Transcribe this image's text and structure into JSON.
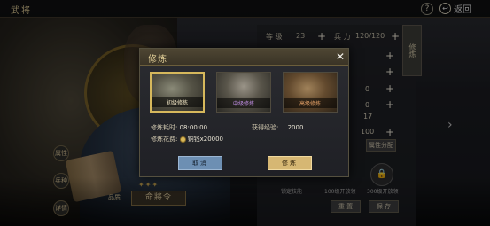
{
  "topbar": {
    "title": "武将",
    "help": "?",
    "back_label": "返回"
  },
  "stats": [
    {
      "label": "等 级",
      "value": "23"
    },
    {
      "label": "兵 力",
      "value": "120/120"
    }
  ],
  "side_tab": "修炼",
  "right_values": [
    "0",
    "0",
    "0",
    "0",
    "17",
    "100"
  ],
  "right_panel": {
    "small_btn": "属性分配",
    "cap_1": "锁定技能",
    "cap_2": "100级开放领",
    "cap_3": "300级开放领",
    "bottom_btn_1": "重 置",
    "bottom_btn_2": "保 存"
  },
  "left_buttons": [
    "属性",
    "兵种",
    "详情"
  ],
  "hero": {
    "tag": "品质",
    "name": "命將令",
    "stars": "✦✦✦"
  },
  "modal": {
    "title": "修炼",
    "options": [
      {
        "label": "初级修炼",
        "selected": true
      },
      {
        "label": "中级修炼",
        "selected": false
      },
      {
        "label": "高级修炼",
        "selected": false
      }
    ],
    "duration_label": "修炼耗时:",
    "duration_value": "08:00:00",
    "exp_label": "获得经验:",
    "exp_value": "2000",
    "cost_label": "修炼花费:",
    "cost_value": "铜钱x20000",
    "cancel_label": "取消",
    "confirm_label": "修炼"
  }
}
